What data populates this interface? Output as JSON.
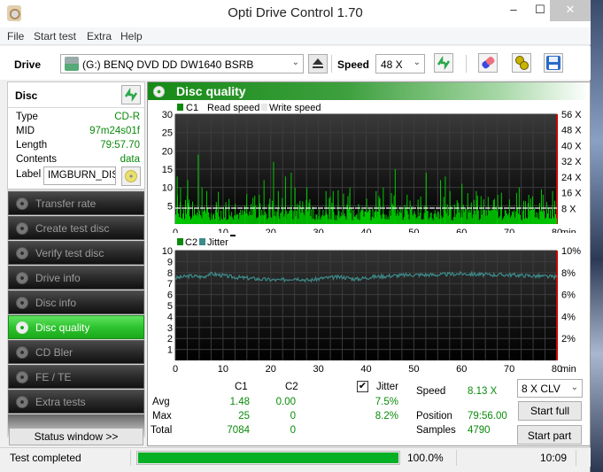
{
  "window": {
    "title": "Opti Drive Control 1.70",
    "min_glyph": "‒",
    "max_glyph": "☐",
    "close_glyph": "✕"
  },
  "menu": [
    "File",
    "Start test",
    "Extra",
    "Help"
  ],
  "toolbar": {
    "drive_label": "Drive",
    "drive_value": "(G:)  BENQ DVD DD DW1640 BSRB",
    "speed_label": "Speed",
    "speed_value": "48 X"
  },
  "disc": {
    "header": "Disc",
    "fields": [
      {
        "key": "Type",
        "value": "CD-R"
      },
      {
        "key": "MID",
        "value": "97m24s01f"
      },
      {
        "key": "Length",
        "value": "79:57.70"
      },
      {
        "key": "Contents",
        "value": "data"
      }
    ],
    "label_key": "Label",
    "label_value": "IMGBURN_DIS"
  },
  "nav": [
    {
      "label": "Transfer rate",
      "active": false
    },
    {
      "label": "Create test disc",
      "active": false
    },
    {
      "label": "Verify test disc",
      "active": false
    },
    {
      "label": "Drive info",
      "active": false
    },
    {
      "label": "Disc info",
      "active": false
    },
    {
      "label": "Disc quality",
      "active": true
    },
    {
      "label": "CD Bler",
      "active": false
    },
    {
      "label": "FE / TE",
      "active": false
    },
    {
      "label": "Extra tests",
      "active": false
    }
  ],
  "status_window_button": "Status window >>",
  "main": {
    "title": "Disc quality",
    "stats": {
      "col_c1": "C1",
      "col_c2": "C2",
      "col_jitter": "Jitter",
      "jitter_checked": true,
      "rows": [
        {
          "label": "Avg",
          "c1": "1.48",
          "c2": "0.00",
          "jitter": "7.5%"
        },
        {
          "label": "Max",
          "c1": "25",
          "c2": "0",
          "jitter": "8.2%"
        },
        {
          "label": "Total",
          "c1": "7084",
          "c2": "0",
          "jitter": ""
        }
      ]
    },
    "info": {
      "speed_label": "Speed",
      "speed_value": "8.13 X",
      "position_label": "Position",
      "position_value": "79:56.00",
      "samples_label": "Samples",
      "samples_value": "4790"
    },
    "speed_mode": "8 X CLV",
    "start_full": "Start full",
    "start_part": "Start part"
  },
  "statusbar": {
    "text": "Test completed",
    "progress_pct": 100.0,
    "progress_text": "100.0%",
    "time": "10:09"
  },
  "chart_data": [
    {
      "type": "bar",
      "title": "C1 / Read speed",
      "legend": [
        {
          "name": "C1",
          "color": "#0a8a0a"
        },
        {
          "name": "Read speed",
          "color": "#ffffff"
        },
        {
          "name": "Write speed",
          "color": "#e8e8e8"
        }
      ],
      "xlabel": "min",
      "x_ticks": [
        0,
        10,
        20,
        30,
        40,
        50,
        60,
        70,
        80
      ],
      "x_range": [
        0,
        80
      ],
      "y_ticks": [
        5,
        10,
        15,
        20,
        25,
        30
      ],
      "ylim": [
        0,
        30
      ],
      "y2_ticks": [
        "8 X",
        "16 X",
        "24 X",
        "32 X",
        "40 X",
        "48 X",
        "56 X"
      ],
      "y2lim": [
        0,
        56
      ],
      "read_speed_x": 8.13,
      "c1_peaks": [
        {
          "x": 0.3,
          "y": 13
        },
        {
          "x": 1,
          "y": 10
        },
        {
          "x": 2.5,
          "y": 12
        },
        {
          "x": 4.7,
          "y": 19
        },
        {
          "x": 5.5,
          "y": 10
        },
        {
          "x": 6.5,
          "y": 9
        },
        {
          "x": 8.5,
          "y": 6
        },
        {
          "x": 10.5,
          "y": 6
        },
        {
          "x": 14.5,
          "y": 5
        },
        {
          "x": 17.5,
          "y": 8
        },
        {
          "x": 18.5,
          "y": 12
        },
        {
          "x": 20.5,
          "y": 17
        },
        {
          "x": 21.5,
          "y": 9
        },
        {
          "x": 23,
          "y": 13
        },
        {
          "x": 24.2,
          "y": 14
        },
        {
          "x": 25,
          "y": 10
        },
        {
          "x": 27.5,
          "y": 10
        },
        {
          "x": 31.5,
          "y": 9
        },
        {
          "x": 33,
          "y": 9
        },
        {
          "x": 36.5,
          "y": 10
        },
        {
          "x": 40,
          "y": 7
        },
        {
          "x": 42,
          "y": 9
        },
        {
          "x": 43.5,
          "y": 10
        },
        {
          "x": 46,
          "y": 15
        },
        {
          "x": 48.5,
          "y": 8
        },
        {
          "x": 52.5,
          "y": 14
        },
        {
          "x": 55.5,
          "y": 12
        },
        {
          "x": 56.5,
          "y": 13
        },
        {
          "x": 60,
          "y": 11
        },
        {
          "x": 63,
          "y": 9
        },
        {
          "x": 67.5,
          "y": 8
        },
        {
          "x": 72,
          "y": 10
        },
        {
          "x": 74,
          "y": 8
        },
        {
          "x": 77,
          "y": 8
        },
        {
          "x": 79,
          "y": 9
        }
      ]
    },
    {
      "type": "line",
      "title": "C2 / Jitter",
      "legend": [
        {
          "name": "C2",
          "color": "#0a8a0a"
        },
        {
          "name": "Jitter",
          "color": "#3e8a8a"
        }
      ],
      "xlabel": "min",
      "x_ticks": [
        0,
        10,
        20,
        30,
        40,
        50,
        60,
        70,
        80
      ],
      "x_range": [
        0,
        80
      ],
      "y_ticks": [
        1,
        2,
        3,
        4,
        5,
        6,
        7,
        8,
        9,
        10
      ],
      "ylim": [
        0,
        10
      ],
      "y2_ticks": [
        "2%",
        "4%",
        "6%",
        "8%",
        "10%"
      ],
      "y2lim": [
        0,
        10
      ],
      "c2_total": 0,
      "jitter_pct": [
        {
          "x": 0,
          "y": 7.5
        },
        {
          "x": 3,
          "y": 7.7
        },
        {
          "x": 6,
          "y": 7.6
        },
        {
          "x": 7,
          "y": 7.9
        },
        {
          "x": 9,
          "y": 7.8
        },
        {
          "x": 12,
          "y": 7.6
        },
        {
          "x": 15,
          "y": 7.5
        },
        {
          "x": 18,
          "y": 7.4
        },
        {
          "x": 22,
          "y": 7.3
        },
        {
          "x": 25,
          "y": 7.5
        },
        {
          "x": 28,
          "y": 7.3
        },
        {
          "x": 31,
          "y": 7.5
        },
        {
          "x": 35,
          "y": 7.6
        },
        {
          "x": 38,
          "y": 7.4
        },
        {
          "x": 41,
          "y": 7.6
        },
        {
          "x": 45,
          "y": 7.7
        },
        {
          "x": 50,
          "y": 7.8
        },
        {
          "x": 55,
          "y": 7.8
        },
        {
          "x": 60,
          "y": 7.9
        },
        {
          "x": 65,
          "y": 7.8
        },
        {
          "x": 70,
          "y": 7.8
        },
        {
          "x": 75,
          "y": 7.7
        },
        {
          "x": 80,
          "y": 7.6
        }
      ]
    }
  ]
}
